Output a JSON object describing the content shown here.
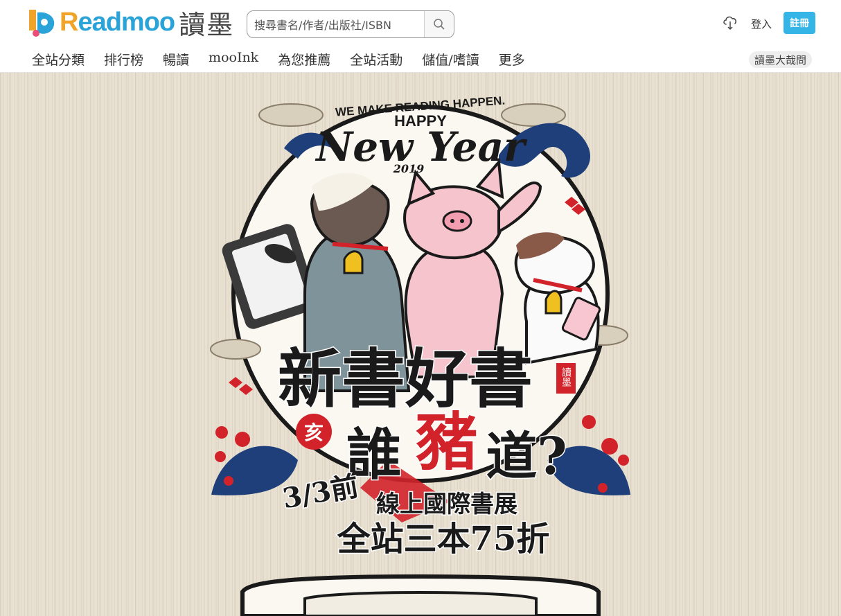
{
  "brand": {
    "name_en_part1": "R",
    "name_en_part2": "eadmoo",
    "name_zh": "讀墨"
  },
  "search": {
    "placeholder": "搜尋書名/作者/出版社/ISBN"
  },
  "header": {
    "login_label": "登入",
    "register_label": "註冊",
    "download_icon": "cloud-download-icon",
    "search_icon": "search-icon"
  },
  "nav": {
    "items": [
      "全站分類",
      "排行榜",
      "暢讀",
      "mooInk",
      "為您推薦",
      "全站活動",
      "儲值/嗜讀",
      "更多"
    ],
    "forum_label": "讀墨大哉問"
  },
  "banner": {
    "tagline": "WE MAKE READING HAPPEN.",
    "happy": "HAPPY",
    "new_year": "New Year",
    "year": "2019",
    "title_line1": "新書好書",
    "seal_text": "讀墨",
    "badge": "亥",
    "title_line2_a": "誰",
    "title_line2_b": "豬",
    "title_line2_c": "道?",
    "date": "3/3前",
    "sub1": "線上國際書展",
    "sub2": "全站三本75折"
  },
  "colors": {
    "accent_blue": "#35b4e6",
    "brand_orange": "#f0a42a",
    "banner_bg": "#e8e0d1",
    "red": "#d2232a",
    "navy": "#1f3f7a"
  }
}
